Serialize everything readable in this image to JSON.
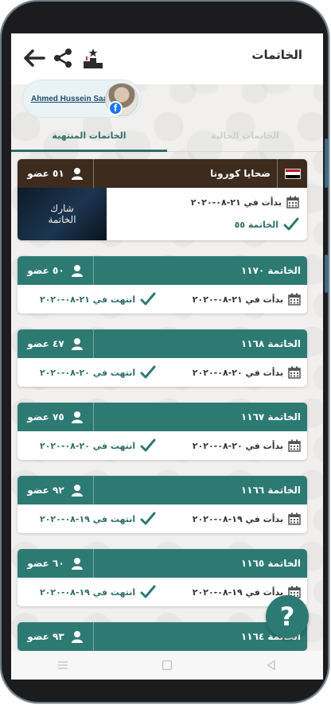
{
  "header": {
    "title": "الخاتمات",
    "back_icon": "back-arrow-icon",
    "share_icon": "share-icon",
    "ranking_icon": "podium-icon"
  },
  "profile": {
    "name": "Ahmed Hussein Saad",
    "badge_icon": "facebook-icon"
  },
  "tabs": [
    {
      "label": "الخاتمات الحالية",
      "active": false
    },
    {
      "label": "الخاتمات المنتهية",
      "active": true
    }
  ],
  "featured": {
    "name": "ضحايا كورونا",
    "members": "٥١ عضو",
    "started": "بدأت في ٢١-٠٨-٢٠٢٠",
    "khatma_number": "الخاتمة ٥٥",
    "image_text_line1": "شارك",
    "image_text_line2": "الخاتمة",
    "flag_colors": [
      "#ce1126",
      "#ffffff",
      "#000000"
    ]
  },
  "khatmas": [
    {
      "name": "الخاتمة ١١٧٠",
      "members": "٥٠ عضو",
      "started": "بدأت في ٢١-٠٨-٢٠٢٠",
      "ended": "انتهت في ٢١-٠٨-٢٠٢٠"
    },
    {
      "name": "الخاتمة ١١٦٨",
      "members": "٤٧ عضو",
      "started": "بدأت في ٢٠-٠٨-٢٠٢٠",
      "ended": "انتهت في ٢٠-٠٨-٢٠٢٠"
    },
    {
      "name": "الخاتمة ١١٦٧",
      "members": "٧٥ عضو",
      "started": "بدأت في ٢٠-٠٨-٢٠٢٠",
      "ended": "انتهت في ٢٠-٠٨-٢٠٢٠"
    },
    {
      "name": "الخاتمة ١١٦٦",
      "members": "٩٢ عضو",
      "started": "بدأت في ١٩-٠٨-٢٠٢٠",
      "ended": "انتهت في ١٩-٠٨-٢٠٢٠"
    },
    {
      "name": "الخاتمة ١١٦٥",
      "members": "٦٠ عضو",
      "started": "بدأت في ١٩-٠٨-٢٠٢٠",
      "ended": "انتهت في ١٩-٠٨-٢٠٢٠"
    },
    {
      "name": "الخاتمة ١١٦٤",
      "members": "٩٣ عضو"
    }
  ],
  "help_button": {
    "label": "?"
  },
  "colors": {
    "primary": "#2d7a73",
    "featured_header": "#3d2b1e",
    "tab_active": "#2f6f68",
    "facebook": "#1877f2"
  },
  "navbar": {
    "icons": [
      "menu-icon",
      "home-square-icon",
      "back-triangle-icon"
    ]
  }
}
